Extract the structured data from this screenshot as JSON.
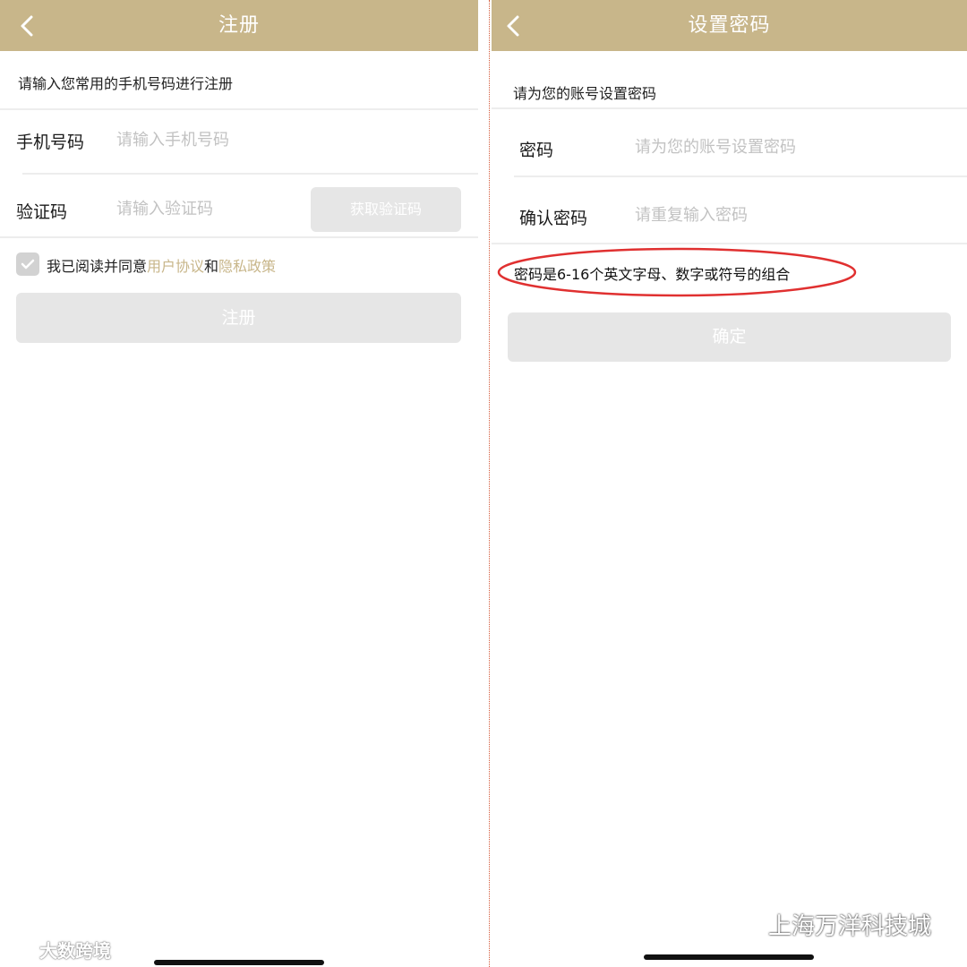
{
  "register_screen": {
    "title": "注册",
    "hint": "请输入您常用的手机号码进行注册",
    "phone_label": "手机号码",
    "phone_placeholder": "请输入手机号码",
    "code_label": "验证码",
    "code_placeholder": "请输入验证码",
    "get_code_label": "获取验证码",
    "agree_prefix": "我已阅读并同意",
    "agree_link_user": "用户协议",
    "agree_and": "和",
    "agree_link_privacy": "隐私政策",
    "register_button": "注册"
  },
  "password_screen": {
    "title": "设置密码",
    "hint": "请为您的账号设置密码",
    "password_label": "密码",
    "password_placeholder": "请为您的账号设置密码",
    "confirm_label": "确认密码",
    "confirm_placeholder": "请重复输入密码",
    "rule_text": "密码是6-16个英文字母、数字或符号的组合",
    "confirm_button": "确定"
  },
  "watermarks": {
    "left": "大数跨境",
    "right": "上海万洋科技城"
  },
  "colors": {
    "navbar": "#c8b68a",
    "link": "#c8b68a",
    "disabled_button": "#e6e6e6",
    "annotation_circle": "#e03030"
  },
  "icons": {
    "back": "chevron-left-icon",
    "checkbox": "checkmark-icon",
    "wechat": "wechat-icon",
    "weibo": "weibo-icon"
  }
}
